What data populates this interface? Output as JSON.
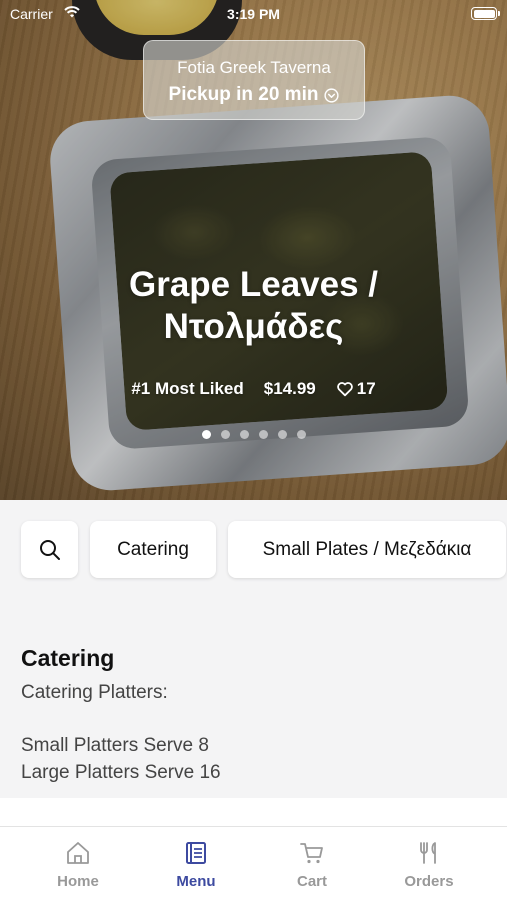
{
  "status_bar": {
    "carrier": "Carrier",
    "time": "3:19 PM"
  },
  "header": {
    "store_name": "Fotia Greek Taverna",
    "pickup_label": "Pickup in 20 min"
  },
  "hero": {
    "title_line1": "Grape Leaves /",
    "title_line2": "Ντολμάδες",
    "rank": "#1 Most Liked",
    "price": "$14.99",
    "likes": "17",
    "slides": {
      "count": 6,
      "active_index": 0
    }
  },
  "filters": [
    {
      "label": "Catering"
    },
    {
      "label": "Small Plates / Μεζεδάκια"
    }
  ],
  "section": {
    "title": "Catering",
    "description_line1": "Catering Platters:",
    "description_line2": "Small Platters Serve 8",
    "description_line3": "Large Platters Serve 16"
  },
  "tabs": [
    {
      "label": "Home",
      "icon": "home-icon",
      "active": false
    },
    {
      "label": "Menu",
      "icon": "menu-book-icon",
      "active": true
    },
    {
      "label": "Cart",
      "icon": "cart-icon",
      "active": false
    },
    {
      "label": "Orders",
      "icon": "fork-knife-icon",
      "active": false
    }
  ],
  "colors": {
    "accent": "#3d4aa0",
    "inactive_tab": "#999999",
    "background": "#f4f4f5"
  }
}
